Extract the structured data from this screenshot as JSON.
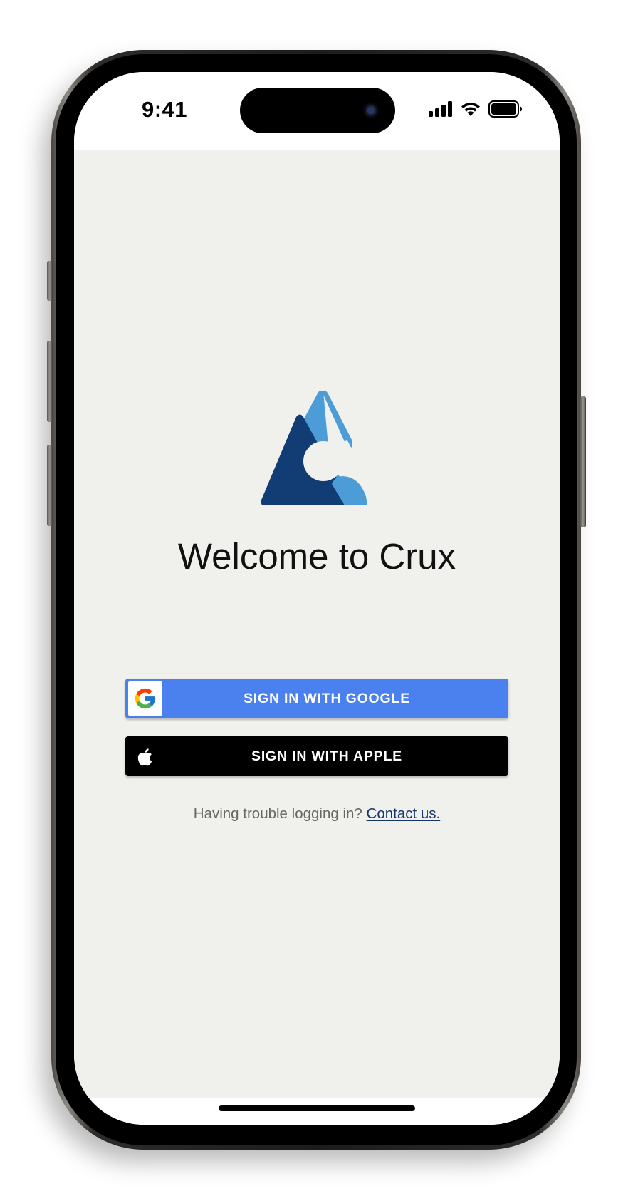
{
  "status_bar": {
    "time": "9:41",
    "icons": [
      "cellular-signal-icon",
      "wifi-icon",
      "battery-icon"
    ]
  },
  "app": {
    "logo": "crux-logo",
    "welcome_title": "Welcome to Crux",
    "google_button_label": "SIGN IN WITH GOOGLE",
    "apple_button_label": "SIGN IN WITH APPLE",
    "help_text": "Having trouble logging in?",
    "contact_link": "Contact us."
  },
  "colors": {
    "background": "#f0f0ed",
    "google_blue": "#4a81ef",
    "apple_black": "#000000",
    "logo_dark": "#123c74",
    "logo_light": "#4c9cd8",
    "link": "#14356b"
  }
}
